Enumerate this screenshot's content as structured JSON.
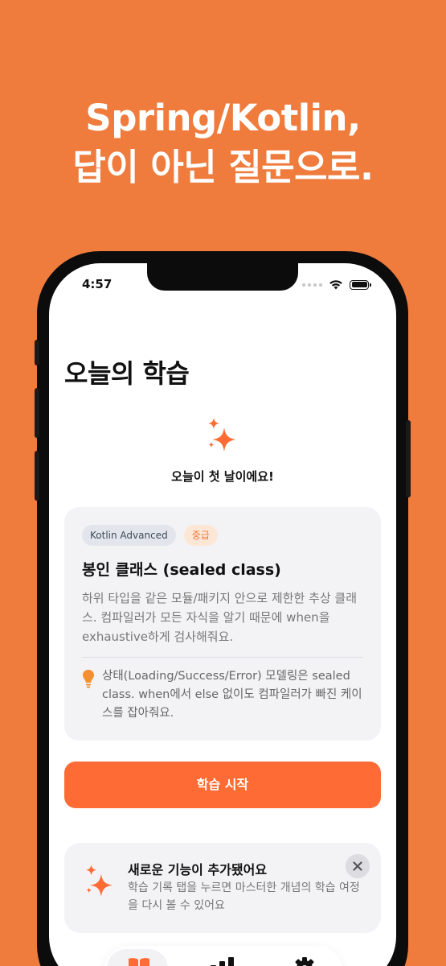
{
  "headline": {
    "line1": "Spring/Kotlin,",
    "line2": "답이 아닌 질문으로."
  },
  "status_bar": {
    "time": "4:57",
    "icons": [
      "signal-dots-icon",
      "wifi-icon",
      "battery-icon"
    ]
  },
  "screen": {
    "title": "오늘의 학습",
    "greeting": {
      "icon": "sparkles-icon",
      "text": "오늘이 첫 날이에요!"
    },
    "lesson_card": {
      "topic_tag": "Kotlin Advanced",
      "level_tag": "중급",
      "title": "봉인 클래스 (sealed class)",
      "description": "하위 타입을 같은 모듈/패키지 안으로 제한한 추상 클래스. 컴파일러가 모든 자식을 알기 때문에 when을 exhaustive하게 검사해줘요.",
      "tip_icon": "lightbulb-icon",
      "tip": "상태(Loading/Success/Error) 모델링은 sealed class. when에서 else 없이도 컴파일러가 빠진 케이스를 잡아줘요."
    },
    "start_button": "학습 시작",
    "notice": {
      "icon": "sparkles-icon",
      "title": "새로운 기능이 추가됐어요",
      "description": "학습 기록 탭을 누르면 마스터한 개념의 학습 여정을 다시 볼 수 있어요",
      "close_icon": "close-icon"
    },
    "tab_bar": {
      "items": [
        {
          "icon": "book-icon",
          "active": true
        },
        {
          "icon": "bar-chart-icon",
          "active": false
        },
        {
          "icon": "gear-icon",
          "active": false
        }
      ]
    }
  },
  "colors": {
    "background": "#EF7B3D",
    "accent": "#FF6B35",
    "card": "#F3F3F6",
    "tip_bulb": "#F5902F"
  }
}
